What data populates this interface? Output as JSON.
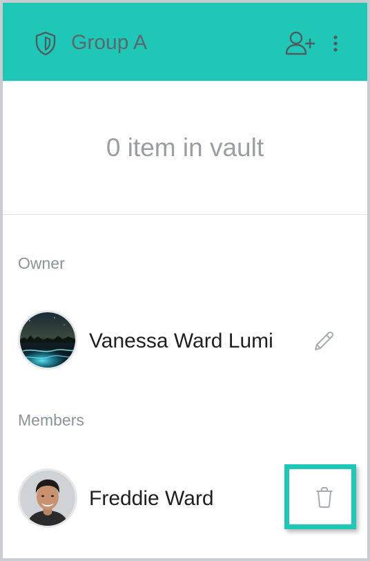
{
  "group": {
    "title": "Group A",
    "icon": "shield-icon",
    "accent_color": "#1fc8b6"
  },
  "header_actions": {
    "add_user_icon": "add-user-icon",
    "more_icon": "more-vertical-icon"
  },
  "vault": {
    "summary": "0 item in vault"
  },
  "owner": {
    "section_label": "Owner",
    "name": "Vanessa Ward Lumi",
    "action_icon": "pencil-icon"
  },
  "members": {
    "section_label": "Members",
    "items": [
      {
        "name": "Freddie Ward",
        "action_icon": "trash-icon"
      }
    ]
  }
}
